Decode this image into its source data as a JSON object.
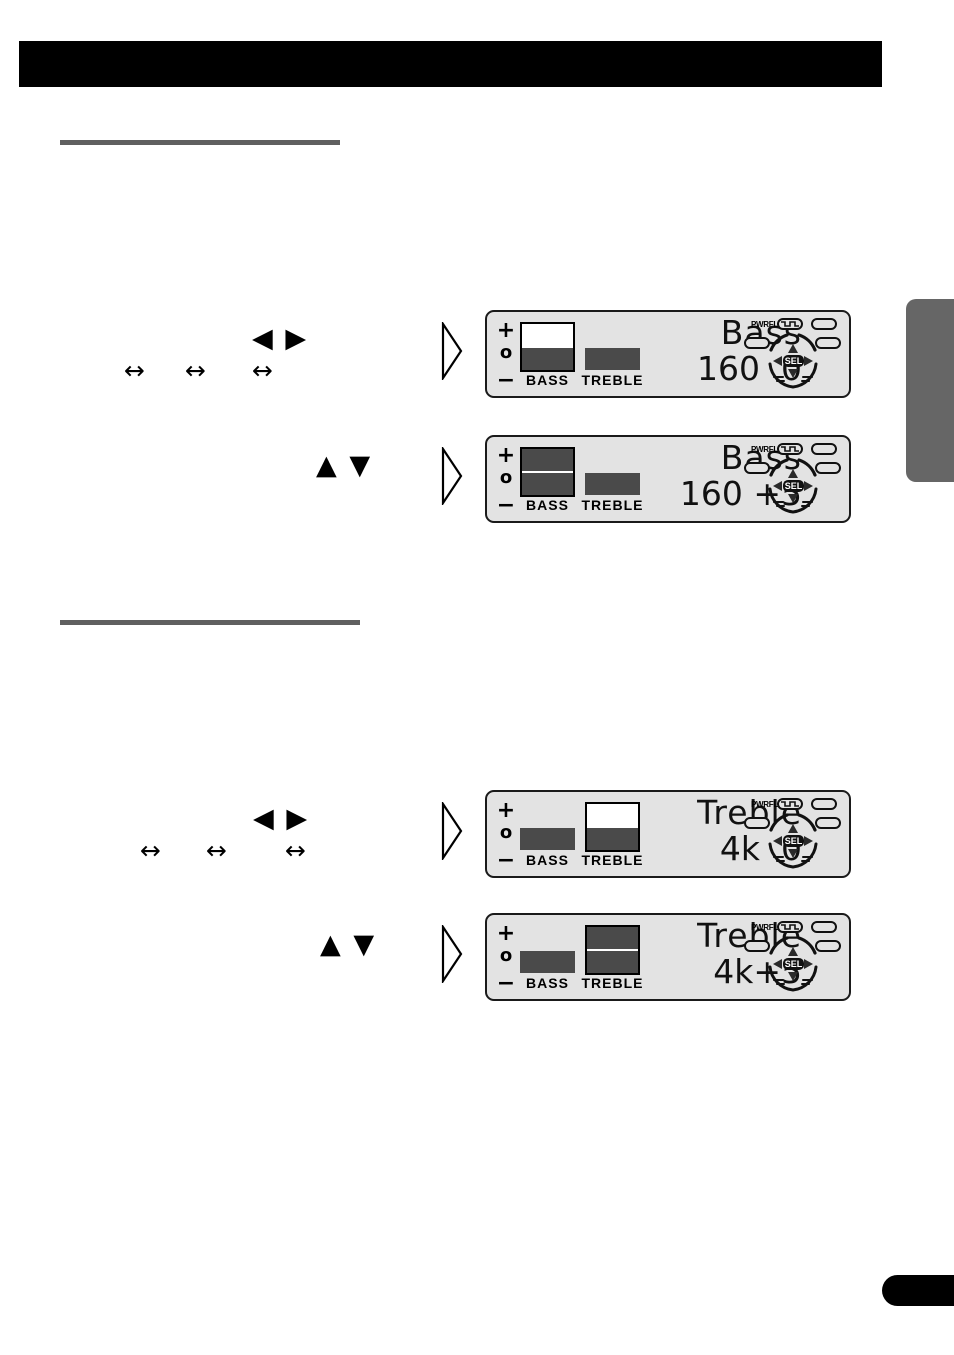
{
  "page": {
    "header_band_color": "#000000",
    "rule_color": "#606060",
    "side_tab_color": "#666666",
    "corner_tab_color": "#000000",
    "panel_bg_color": "#e3e3e3",
    "meter_fill_color": "#4a4a4a"
  },
  "sections": [
    {
      "id": "bass",
      "rule": "",
      "steps": [
        {
          "glyph_tri": "◀ ▶",
          "glyph_links": [
            "↔",
            "↔",
            "↔"
          ]
        },
        {
          "glyph_tri": "▲ ▼",
          "glyph_links": []
        }
      ]
    },
    {
      "id": "treble",
      "rule": "",
      "steps": [
        {
          "glyph_tri": "◀ ▶",
          "glyph_links": [
            "↔",
            "↔",
            "↔"
          ]
        },
        {
          "glyph_tri": "▲ ▼",
          "glyph_links": []
        }
      ]
    }
  ],
  "panels": [
    {
      "id": "panel-bass-0",
      "scale": {
        "plus": "+",
        "zero": "o",
        "minus": "−"
      },
      "bass_meter": {
        "label": "BASS",
        "selected": true,
        "segments": 1
      },
      "treble_meter": {
        "label": "TREBLE",
        "selected": false,
        "segments": 1
      },
      "readout": {
        "line1": "Bass",
        "line2": "160  0"
      },
      "cluster": {
        "pwrfl": "PWRFL",
        "sel": "SEL"
      }
    },
    {
      "id": "panel-bass-1",
      "scale": {
        "plus": "+",
        "zero": "o",
        "minus": "−"
      },
      "bass_meter": {
        "label": "BASS",
        "selected": true,
        "segments": 2
      },
      "treble_meter": {
        "label": "TREBLE",
        "selected": false,
        "segments": 1
      },
      "readout": {
        "line1": "Bass",
        "line2": "160 +5"
      },
      "cluster": {
        "pwrfl": "PWRFL",
        "sel": "SEL"
      }
    },
    {
      "id": "panel-treble-0",
      "scale": {
        "plus": "+",
        "zero": "o",
        "minus": "−"
      },
      "bass_meter": {
        "label": "BASS",
        "selected": false,
        "segments": 1
      },
      "treble_meter": {
        "label": "TREBLE",
        "selected": true,
        "segments": 1
      },
      "readout": {
        "line1": "Treble",
        "line2": "4k  0"
      },
      "cluster": {
        "pwrfl": "PWRFL",
        "sel": "SEL"
      }
    },
    {
      "id": "panel-treble-1",
      "scale": {
        "plus": "+",
        "zero": "o",
        "minus": "−"
      },
      "bass_meter": {
        "label": "BASS",
        "selected": false,
        "segments": 1
      },
      "treble_meter": {
        "label": "TREBLE",
        "selected": true,
        "segments": 2
      },
      "readout": {
        "line1": "Treble",
        "line2": "4k+5"
      },
      "cluster": {
        "pwrfl": "PWRFL",
        "sel": "SEL"
      }
    }
  ]
}
